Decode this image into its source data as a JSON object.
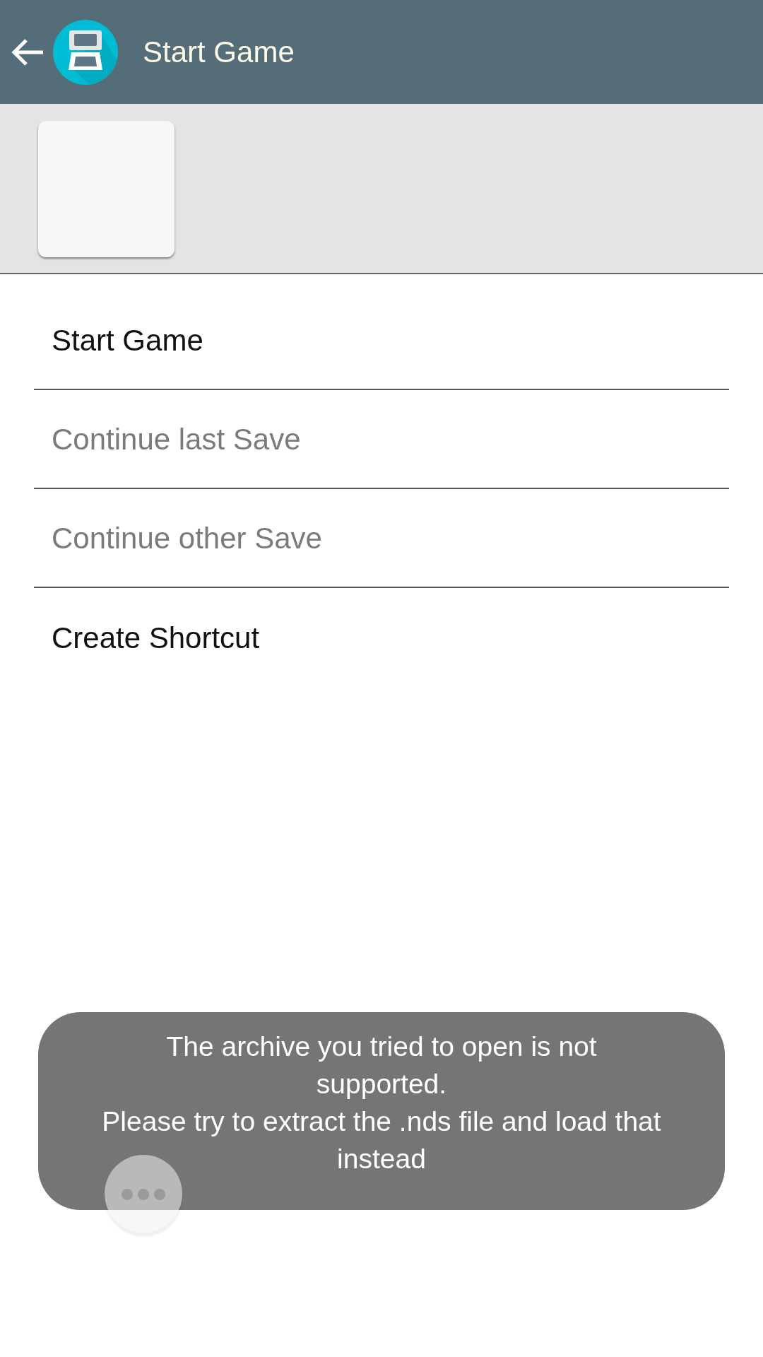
{
  "app_bar": {
    "title": "Start Game"
  },
  "menu": [
    {
      "label": "Start Game",
      "disabled": false
    },
    {
      "label": "Continue last Save",
      "disabled": true
    },
    {
      "label": "Continue other Save",
      "disabled": true
    },
    {
      "label": "Create Shortcut",
      "disabled": false
    }
  ],
  "toast": {
    "lines": [
      "The archive you tried to open is not supported.",
      "Please try to extract the .nds file and load that instead"
    ]
  }
}
